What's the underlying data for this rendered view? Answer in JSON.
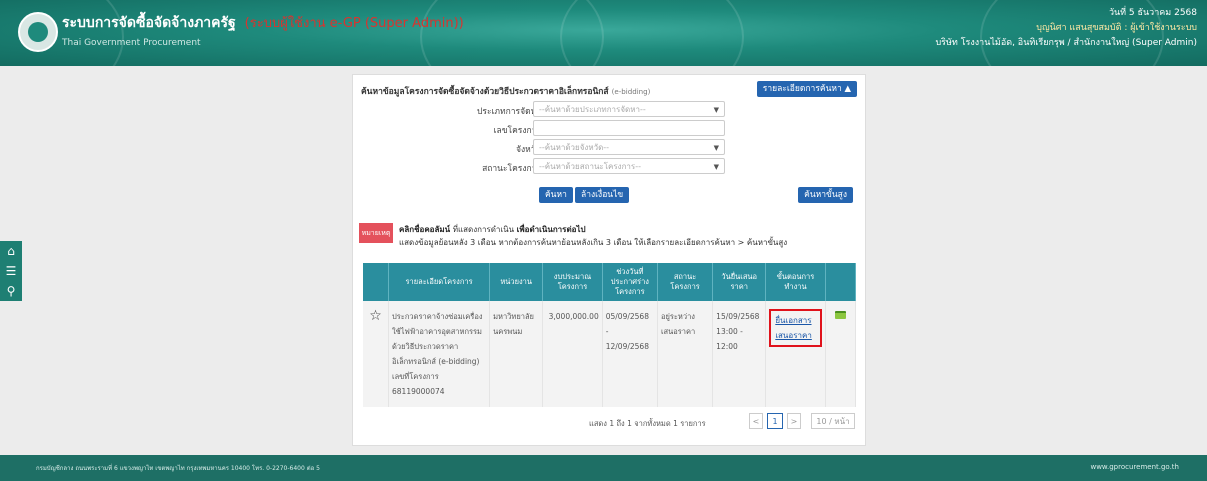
{
  "header": {
    "system_title": "ระบบการจัดซื้อจัดจ้างภาครัฐ",
    "system_title_red": "(ระบบผู้ใช้งาน e-GP (Super Admin))",
    "system_subtitle": "Thai Government Procurement",
    "date": "วันที่ 5 ธันวาคม 2568",
    "user_name": "บุญนิศา แสนสุขสมบัติ : ผู้เข้าใช้งานระบบ",
    "org": "บริษัท โรงงานไม้อัด, อินทิเรียกรุพ / สำนักงานใหญ่ (Super Admin)"
  },
  "sidebar": {
    "icons": [
      "home-icon",
      "menu-icon",
      "search-icon"
    ]
  },
  "panel": {
    "title": "ค้นหาข้อมูลโครงการจัดซื้อจัดจ้างด้วยวิธีประกวดราคาอิเล็กทรอนิกส์",
    "title_code": "(e-bidding)",
    "toggle_label": "รายละเอียดการค้นหา ▲",
    "fields": [
      {
        "label": "ประเภทการจัดหา",
        "value": "--ค้นหาด้วยประเภทการจัดหา--",
        "type": "select"
      },
      {
        "label": "เลขโครงการ",
        "value": "",
        "type": "input"
      },
      {
        "label": "จังหวัด",
        "value": "--ค้นหาด้วยจังหวัด--",
        "type": "select"
      },
      {
        "label": "สถานะโครงการ",
        "value": "--ค้นหาด้วยสถานะโครงการ--",
        "type": "select"
      }
    ],
    "search_label": "ค้นหา",
    "clear_label": "ล้างเงื่อนไข",
    "more_label": "ค้นหาขั้นสูง",
    "note_badge": "หมายเหตุ",
    "note_line1_a": "คลิกชื่อคอลัมน์",
    "note_line1_b": "ที่แสดงการดำเนิน",
    "note_line1_c": "เพื่อดำเนินการต่อไป",
    "note_line2": "แสดงข้อมูลย้อนหลัง 3 เดือน หากต้องการค้นหาย้อนหลังเกิน 3 เดือน ให้เลือกรายละเอียดการค้นหา > ค้นหาขั้นสูง"
  },
  "table": {
    "headers": [
      "",
      "รายละเอียดโครงการ",
      "หน่วยงาน",
      "งบประมาณ โครงการ",
      "ช่วงวันที่ ประกาศร่าง โครงการ",
      "สถานะ โครงการ",
      "วันยื่นเสนอ ราคา",
      "ขั้นตอนการ ทำงาน",
      ""
    ],
    "rows": [
      {
        "project": "ประกวดราคาจ้างซ่อมเครื่องใช้ไฟฟ้าอาคารอุตสาหกรรม ด้วยวิธีประกวดราคาอิเล็กทรอนิกส์ (e-bidding) เลขที่โครงการ 68119000074",
        "agency": "มหาวิทยาลัยนครพนม",
        "budget": "3,000,000.00",
        "date_range": "05/09/2568 - 12/09/2568",
        "status": "อยู่ระหว่างเสนอราคา",
        "bid_date": "15/09/2568 13:00 - 12:00",
        "step_link": "ยื่นเอกสารเสนอราคา"
      }
    ]
  },
  "pagination": {
    "info": "แสดง 1 ถึง 1 จากทั้งหมด 1 รายการ",
    "prev": "<",
    "page": "1",
    "next": ">",
    "size": "10 / หน้า"
  },
  "footer": {
    "left": "กรมบัญชีกลาง ถนนพระรามที่ 6 แขวงพญาไท เขตพญาไท กรุงเทพมหานคร 10400 โทร. 0-2270-6400 ต่อ 5",
    "right": "www.gprocurement.go.th"
  }
}
